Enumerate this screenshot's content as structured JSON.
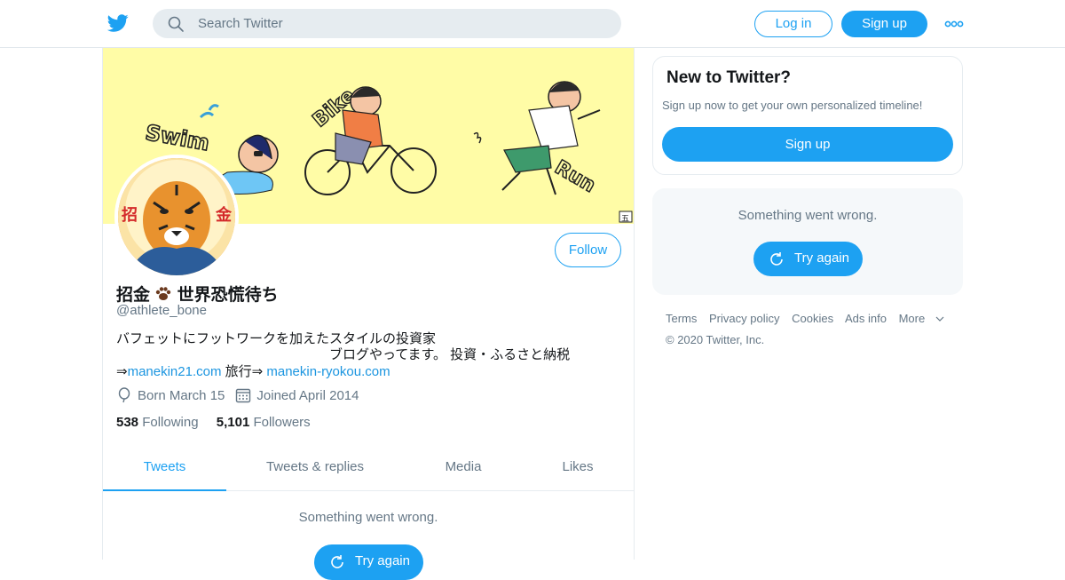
{
  "topbar": {
    "search_placeholder": "Search Twitter",
    "login_label": "Log in",
    "signup_label": "Sign up"
  },
  "profile": {
    "name": "招金",
    "name_suffix": "世界恐慌待ち",
    "handle": "@athlete_bone",
    "bio_line1": "バフェットにフットワークを加えたスタイルの投資家",
    "bio_line2": "ブログやってます。 投資・ふるさと納税",
    "link_prefix": "⇒",
    "link1": "manekin21.com",
    "link_mid": " 旅行⇒ ",
    "link2": "manekin-ryokou.com",
    "born": "Born March 15",
    "joined": "Joined April 2014",
    "following_count": "538",
    "following_label": "Following",
    "followers_count": "5,101",
    "followers_label": "Followers",
    "follow_label": "Follow",
    "banner_words": [
      "Swim",
      "Bike",
      "Run"
    ],
    "banner_mark": "五",
    "avatar_chars": [
      "招",
      "金"
    ]
  },
  "tabs": [
    {
      "label": "Tweets",
      "active": true
    },
    {
      "label": "Tweets & replies",
      "active": false
    },
    {
      "label": "Media",
      "active": false
    },
    {
      "label": "Likes",
      "active": false
    }
  ],
  "timeline": {
    "error_text": "Something went wrong.",
    "retry_label": "Try again"
  },
  "sidebar": {
    "new_title": "New to Twitter?",
    "new_sub": "Sign up now to get your own personalized timeline!",
    "signup_label": "Sign up",
    "error_text": "Something went wrong.",
    "retry_label": "Try again"
  },
  "footer": {
    "links": [
      "Terms",
      "Privacy policy",
      "Cookies",
      "Ads info",
      "More"
    ],
    "copyright": "© 2020 Twitter, Inc."
  },
  "colors": {
    "accent": "#1da1f2",
    "banner_bg": "#fffca6",
    "muted": "#657786"
  }
}
